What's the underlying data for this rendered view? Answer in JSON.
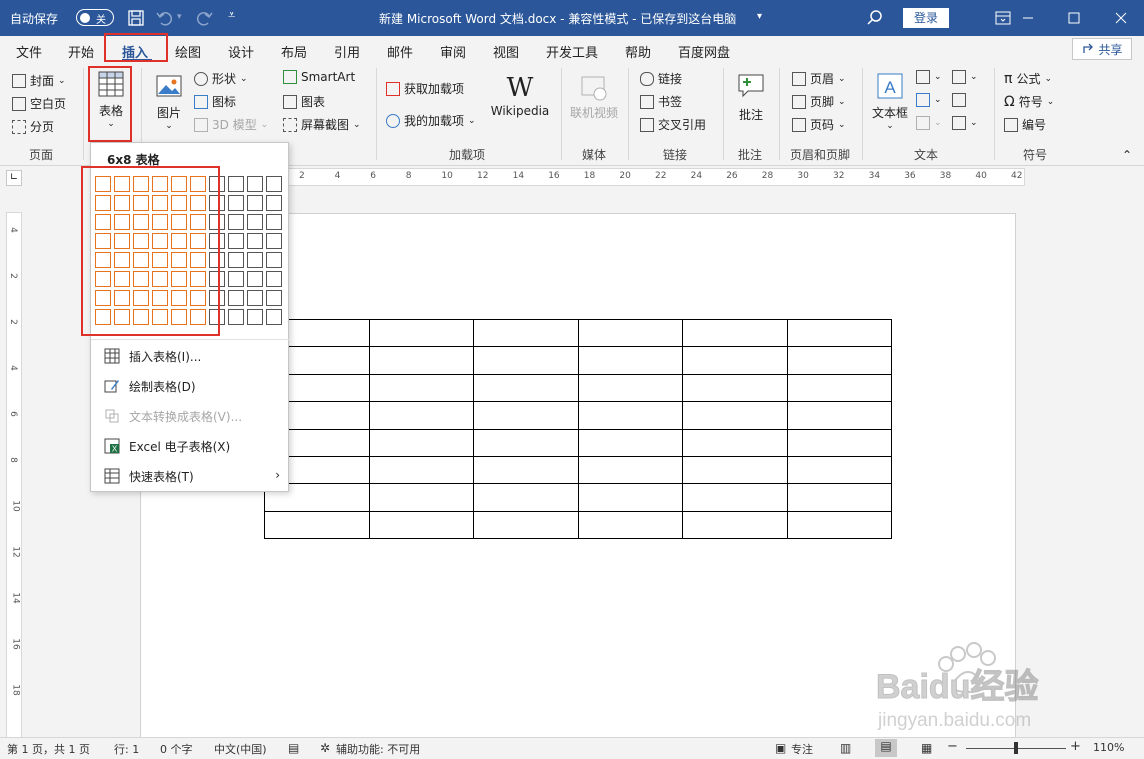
{
  "titlebar": {
    "autosave": "自动保存",
    "toggle_state": "关",
    "document_title": "新建 Microsoft Word 文档.docx  -  兼容性模式  -  已保存到这台电脑",
    "login": "登录"
  },
  "tabs": [
    "文件",
    "开始",
    "插入",
    "绘图",
    "设计",
    "布局",
    "引用",
    "邮件",
    "审阅",
    "视图",
    "开发工具",
    "帮助",
    "百度网盘"
  ],
  "share": "共享",
  "ribbon": {
    "pages": {
      "cover": "封面",
      "blank": "空白页",
      "break": "分页",
      "group": "页面"
    },
    "table": {
      "label": "表格"
    },
    "illustrations": {
      "pictures": "图片",
      "shapes": "形状",
      "icons": "图标",
      "model3d": "3D 模型",
      "smartart": "SmartArt",
      "chart": "图表",
      "screenshot": "屏幕截图"
    },
    "addins": {
      "get": "获取加载项",
      "my": "我的加载项",
      "wikipedia": "Wikipedia",
      "group": "加载项"
    },
    "media": {
      "online_video": "联机视频",
      "group": "媒体"
    },
    "links": {
      "link": "链接",
      "bookmark": "书签",
      "crossref": "交叉引用",
      "group": "链接"
    },
    "comments": {
      "comment": "批注",
      "group": "批注"
    },
    "headerfooter": {
      "header": "页眉",
      "footer": "页脚",
      "pagenum": "页码",
      "group": "页眉和页脚"
    },
    "text": {
      "textbox": "文本框",
      "group": "文本"
    },
    "symbols": {
      "equation": "公式",
      "symbol": "符号",
      "number": "编号",
      "group": "符号"
    }
  },
  "dropdown": {
    "grid_label": "6x8 表格",
    "grid_cols": 10,
    "grid_rows": 8,
    "selected_cols": 6,
    "selected_rows": 8,
    "items": [
      {
        "label": "插入表格(I)...",
        "enabled": true
      },
      {
        "label": "绘制表格(D)",
        "enabled": true
      },
      {
        "label": "文本转换成表格(V)...",
        "enabled": false
      },
      {
        "label": "Excel 电子表格(X)",
        "enabled": true
      },
      {
        "label": "快速表格(T)",
        "enabled": true
      }
    ]
  },
  "ruler": {
    "h_ticks": [
      "2",
      "4",
      "6",
      "8",
      "10",
      "12",
      "14",
      "16",
      "18",
      "20",
      "22",
      "24",
      "26",
      "28",
      "30",
      "32",
      "34",
      "36",
      "38",
      "40",
      "42"
    ],
    "v_ticks": [
      "4",
      "2",
      "2",
      "4",
      "6",
      "8",
      "10",
      "12",
      "14",
      "16",
      "18"
    ]
  },
  "document": {
    "table_rows": 8,
    "table_cols": 6
  },
  "status": {
    "page": "第 1 页，共 1 页",
    "row": "行: 1",
    "words": "0 个字",
    "lang": "中文(中国)",
    "accessibility": "辅助功能: 不可用",
    "focus": "专注",
    "zoom": "110%"
  },
  "watermark": {
    "brand": "Baidu经验",
    "url": "jingyan.baidu.com"
  },
  "colors": {
    "brand": "#2b579a",
    "highlight": "#e0302a",
    "grid_selected": "#e8731e"
  }
}
